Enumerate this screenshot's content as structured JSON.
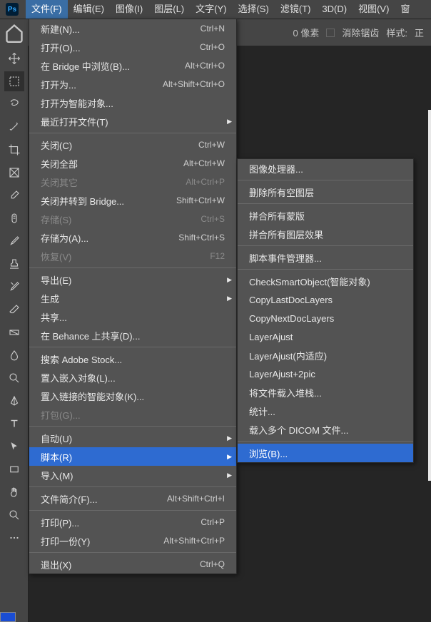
{
  "menubar": {
    "items": [
      "文件(F)",
      "编辑(E)",
      "图像(I)",
      "图层(L)",
      "文字(Y)",
      "选择(S)",
      "滤镜(T)",
      "3D(D)",
      "视图(V)",
      "窗"
    ]
  },
  "toolbar": {
    "pixel_label": "0 像素",
    "antialias": "消除锯齿",
    "style": "样式:",
    "normal": "正"
  },
  "file_menu": [
    {
      "label": "新建(N)...",
      "sc": "Ctrl+N"
    },
    {
      "label": "打开(O)...",
      "sc": "Ctrl+O"
    },
    {
      "label": "在 Bridge 中浏览(B)...",
      "sc": "Alt+Ctrl+O"
    },
    {
      "label": "打开为...",
      "sc": "Alt+Shift+Ctrl+O"
    },
    {
      "label": "打开为智能对象..."
    },
    {
      "label": "最近打开文件(T)",
      "sub": true
    },
    {
      "sep": true
    },
    {
      "label": "关闭(C)",
      "sc": "Ctrl+W"
    },
    {
      "label": "关闭全部",
      "sc": "Alt+Ctrl+W"
    },
    {
      "label": "关闭其它",
      "sc": "Alt+Ctrl+P",
      "disabled": true
    },
    {
      "label": "关闭并转到 Bridge...",
      "sc": "Shift+Ctrl+W"
    },
    {
      "label": "存储(S)",
      "sc": "Ctrl+S",
      "disabled": true
    },
    {
      "label": "存储为(A)...",
      "sc": "Shift+Ctrl+S"
    },
    {
      "label": "恢复(V)",
      "sc": "F12",
      "disabled": true
    },
    {
      "sep": true
    },
    {
      "label": "导出(E)",
      "sub": true
    },
    {
      "label": "生成",
      "sub": true
    },
    {
      "label": "共享..."
    },
    {
      "label": "在 Behance 上共享(D)..."
    },
    {
      "sep": true
    },
    {
      "label": "搜索 Adobe Stock..."
    },
    {
      "label": "置入嵌入对象(L)..."
    },
    {
      "label": "置入链接的智能对象(K)..."
    },
    {
      "label": "打包(G)...",
      "disabled": true
    },
    {
      "sep": true
    },
    {
      "label": "自动(U)",
      "sub": true
    },
    {
      "label": "脚本(R)",
      "sub": true,
      "highlight": true
    },
    {
      "label": "导入(M)",
      "sub": true
    },
    {
      "sep": true
    },
    {
      "label": "文件简介(F)...",
      "sc": "Alt+Shift+Ctrl+I"
    },
    {
      "sep": true
    },
    {
      "label": "打印(P)...",
      "sc": "Ctrl+P"
    },
    {
      "label": "打印一份(Y)",
      "sc": "Alt+Shift+Ctrl+P"
    },
    {
      "sep": true
    },
    {
      "label": "退出(X)",
      "sc": "Ctrl+Q"
    }
  ],
  "script_submenu": [
    {
      "label": "图像处理器..."
    },
    {
      "sep": true
    },
    {
      "label": "删除所有空图层"
    },
    {
      "sep": true
    },
    {
      "label": "拼合所有蒙版"
    },
    {
      "label": "拼合所有图层效果"
    },
    {
      "sep": true
    },
    {
      "label": "脚本事件管理器..."
    },
    {
      "sep": true
    },
    {
      "label": "CheckSmartObject(智能对象)"
    },
    {
      "label": "CopyLastDocLayers"
    },
    {
      "label": "CopyNextDocLayers"
    },
    {
      "label": "LayerAjust"
    },
    {
      "label": "LayerAjust(内适应)"
    },
    {
      "label": "LayerAjust+2pic"
    },
    {
      "label": "将文件载入堆栈..."
    },
    {
      "label": "统计..."
    },
    {
      "label": "载入多个 DICOM 文件..."
    },
    {
      "sep": true
    },
    {
      "label": "浏览(B)...",
      "highlight": true
    }
  ]
}
